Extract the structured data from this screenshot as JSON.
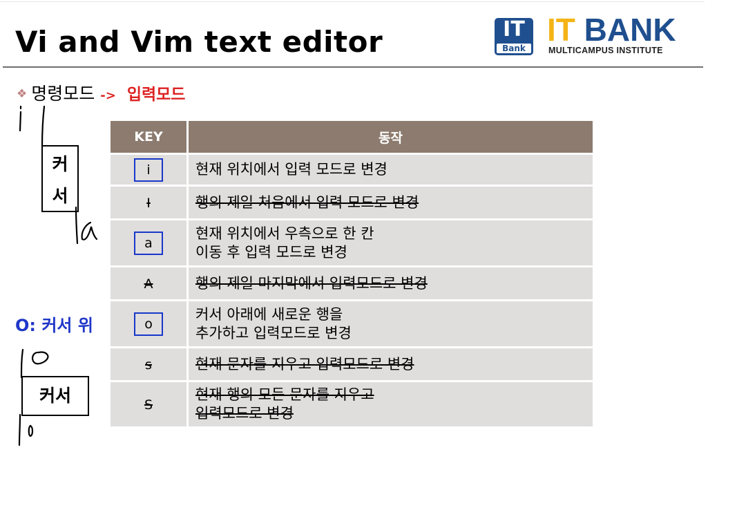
{
  "title": "Vi and Vim text editor",
  "logo": {
    "badge_top": "IT",
    "badge_bottom": "Bank",
    "name_part1": "IT",
    "name_part2": "BANK",
    "subtitle": "MULTICAMPUS INSTITUTE"
  },
  "bullet": {
    "icon": "diamond-bullet-icon",
    "label": "명령모드",
    "arrow": "->",
    "target": "입력모드"
  },
  "table": {
    "headers": {
      "key": "KEY",
      "action": "동작"
    },
    "rows": [
      {
        "key": "i",
        "action_lines": [
          "현재 위치에서 입력 모드로 변경"
        ],
        "boxed": true,
        "struck": false
      },
      {
        "key": "I",
        "action_lines": [
          "행의 제일 처음에서 입력 모드로 변경"
        ],
        "boxed": false,
        "struck": true
      },
      {
        "key": "a",
        "action_lines": [
          "현재 위치에서 우측으로 한 칸",
          "이동 후 입력 모드로 변경"
        ],
        "boxed": true,
        "struck": false
      },
      {
        "key": "A",
        "action_lines": [
          "행의 제일 마지막에서 입력모드로 변경"
        ],
        "boxed": false,
        "struck": true
      },
      {
        "key": "o",
        "action_lines": [
          "커서 아래에 새로운 행을",
          "추가하고 입력모드로 변경"
        ],
        "boxed": true,
        "struck": false
      },
      {
        "key": "s",
        "action_lines": [
          "현재 문자를 지우고 입력모드로 변경"
        ],
        "boxed": false,
        "struck": true
      },
      {
        "key": "S",
        "action_lines": [
          "현재 행의 모든 문자를 지우고",
          "입력모드로 변경"
        ],
        "boxed": false,
        "struck": true
      }
    ]
  },
  "notes": {
    "o_note": "O: 커서 위",
    "cursor_vertical": [
      "커",
      "서"
    ],
    "cursor_horizontal": "커서"
  },
  "colors": {
    "header_bg": "#8c7b6e",
    "row_bg": "#e0dddd",
    "accent_red": "#dd2222",
    "accent_blue": "#1f36c8",
    "logo_blue": "#1f4f8f",
    "logo_yellow": "#f4b418"
  }
}
